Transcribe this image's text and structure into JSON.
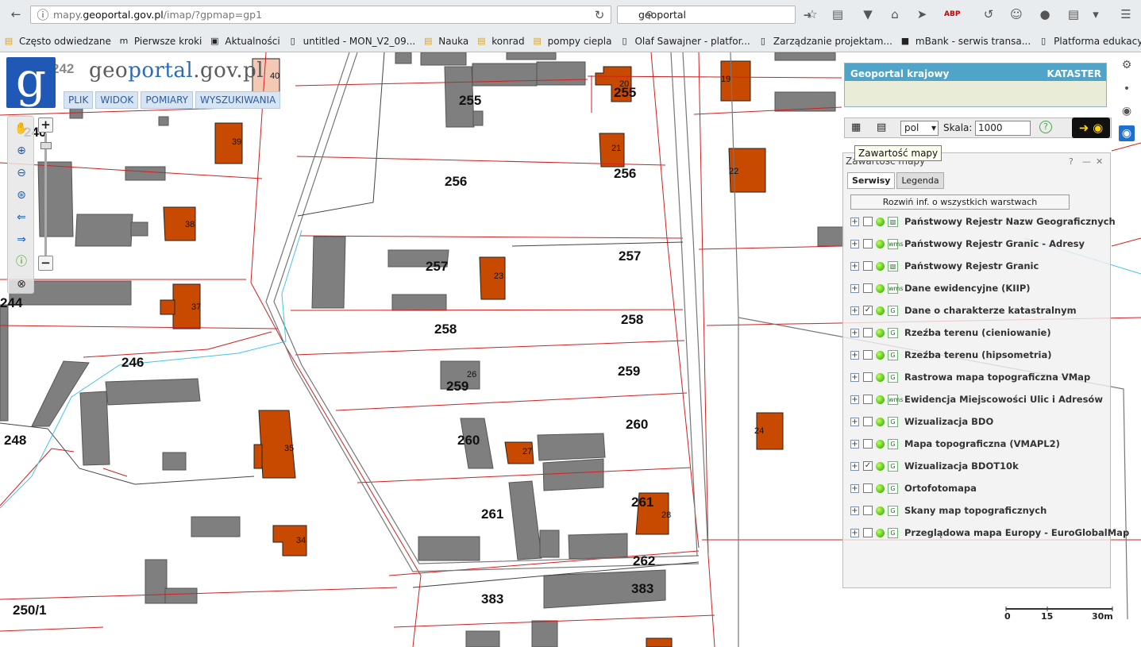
{
  "browser": {
    "url_prefix": "mapy.",
    "url_host": "geoportal.gov.pl",
    "url_path": "/imap/?gpmap=gp1",
    "search_value": "geoportal",
    "bookmarks": [
      {
        "label": "Często odwiedzane",
        "icon": "folder-icon"
      },
      {
        "label": "Pierwsze kroki",
        "icon": "m-icon"
      },
      {
        "label": "Aktualności",
        "icon": "rss-icon"
      },
      {
        "label": "untitled - MON_V2_09...",
        "icon": "page-icon"
      },
      {
        "label": "Nauka",
        "icon": "folder-icon"
      },
      {
        "label": "konrad",
        "icon": "folder-icon"
      },
      {
        "label": "pompy ciepla",
        "icon": "folder-icon"
      },
      {
        "label": "Olaf Sawajner - platfor...",
        "icon": "page-icon"
      },
      {
        "label": "Zarządzanie projektam...",
        "icon": "page-icon"
      },
      {
        "label": "mBank - serwis transa...",
        "icon": "mbank-icon"
      },
      {
        "label": "Platforma edukacyjna ...",
        "icon": "page-icon"
      }
    ]
  },
  "app": {
    "logo_letter": "g",
    "logo_text_a": "geo",
    "logo_text_b": "portal",
    "logo_text_c": ".gov.pl",
    "menu": [
      "PLIK",
      "WIDOK",
      "POMIARY",
      "WYSZUKIWANIA"
    ],
    "kataster_title": "Geoportal krajowy",
    "kataster_label": "KATASTER",
    "lang_value": "pol",
    "scale_label": "Skala:",
    "scale_value": "1000",
    "tooltip": "Zawartość mapy"
  },
  "panel": {
    "title": "Zawartość mapy",
    "tabs": [
      "Serwisy",
      "Legenda"
    ],
    "expand_button": "Rozwiń inf. o wszystkich warstwach",
    "layers": [
      {
        "name": "Państwowy Rejestr Nazw Geograficznych",
        "checked": false,
        "icon": "map"
      },
      {
        "name": "Państwowy Rejestr Granic - Adresy",
        "checked": false,
        "icon": "wms"
      },
      {
        "name": "Państwowy Rejestr Granic",
        "checked": false,
        "icon": "map"
      },
      {
        "name": "Dane ewidencyjne (KIIP)",
        "checked": false,
        "icon": "wms"
      },
      {
        "name": "Dane o charakterze katastralnym",
        "checked": true,
        "icon": "g"
      },
      {
        "name": "Rzeźba terenu (cieniowanie)",
        "checked": false,
        "icon": "g"
      },
      {
        "name": "Rzeźba terenu (hipsometria)",
        "checked": false,
        "icon": "g"
      },
      {
        "name": "Rastrowa mapa topograficzna VMap",
        "checked": false,
        "icon": "g"
      },
      {
        "name": "Ewidencja Miejscowości Ulic i Adresów",
        "checked": false,
        "icon": "wms"
      },
      {
        "name": "Wizualizacja BDO",
        "checked": false,
        "icon": "g"
      },
      {
        "name": "Mapa topograficzna (VMAPL2)",
        "checked": false,
        "icon": "g"
      },
      {
        "name": "Wizualizacja BDOT10k",
        "checked": true,
        "icon": "g"
      },
      {
        "name": "Ortofotomapa",
        "checked": false,
        "icon": "g"
      },
      {
        "name": "Skany map topograficznych",
        "checked": false,
        "icon": "g"
      },
      {
        "name": "Przeglądowa mapa Europy - EuroGlobalMap",
        "checked": false,
        "icon": "g"
      }
    ]
  },
  "map": {
    "parcels": [
      "242",
      "240",
      "255",
      "255",
      "256",
      "256",
      "257",
      "257",
      "258",
      "258",
      "259",
      "259",
      "260",
      "260",
      "261",
      "261",
      "262",
      "383",
      "383",
      "246",
      "248",
      "244",
      "250/1"
    ],
    "buildings": [
      "40",
      "39",
      "38",
      "37",
      "35",
      "34",
      "19",
      "20",
      "21",
      "22",
      "23",
      "24",
      "26",
      "27",
      "28"
    ],
    "scale_ticks": [
      "0",
      "15",
      "30m"
    ]
  },
  "colors": {
    "parcel_line": "#d02020",
    "building_orange": "#c84a00",
    "building_gray": "#7f7f7f",
    "road": "#777777",
    "stream": "#3fc6e6"
  }
}
